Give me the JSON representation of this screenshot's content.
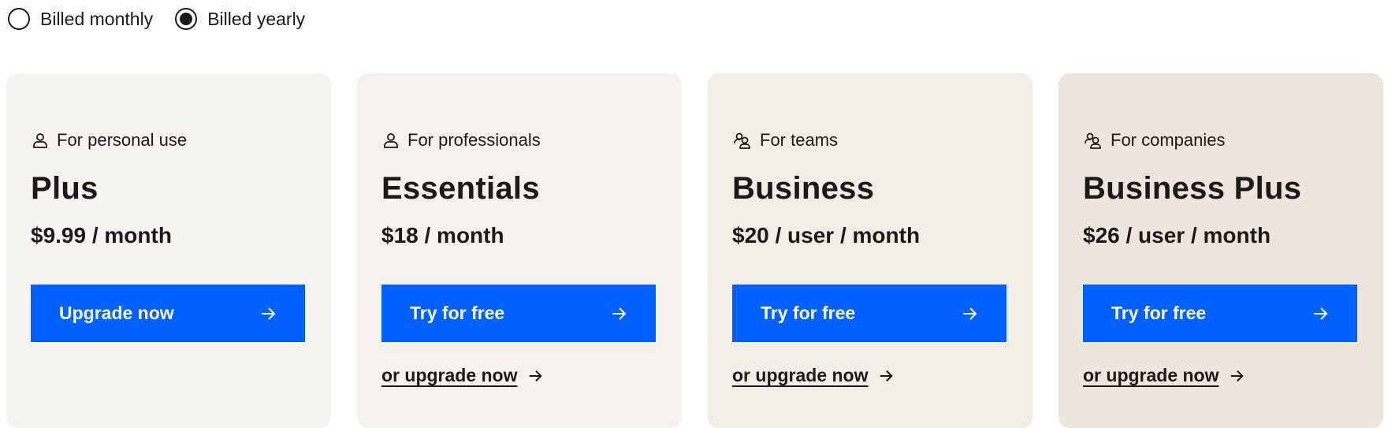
{
  "billing": {
    "options": [
      {
        "label": "Billed monthly",
        "selected": false
      },
      {
        "label": "Billed yearly",
        "selected": true
      }
    ]
  },
  "plans": [
    {
      "audience": "For personal use",
      "audience_icon": "person-icon",
      "name": "Plus",
      "price": "$9.99 / month",
      "cta": "Upgrade now",
      "secondary": "",
      "bg": "#f7f5f2"
    },
    {
      "audience": "For professionals",
      "audience_icon": "person-icon",
      "name": "Essentials",
      "price": "$18 / month",
      "cta": "Try for free",
      "secondary": "or upgrade now",
      "bg": "#f5f2ee"
    },
    {
      "audience": "For teams",
      "audience_icon": "people-icon",
      "name": "Business",
      "price": "$20 / user / month",
      "cta": "Try for free",
      "secondary": "or upgrade now",
      "bg": "#f1ede7"
    },
    {
      "audience": "For companies",
      "audience_icon": "people-icon",
      "name": "Business Plus",
      "price": "$26 / user / month",
      "cta": "Try for free",
      "secondary": "or upgrade now",
      "bg": "#ece6df"
    }
  ],
  "colors": {
    "accent": "#0061fe",
    "text": "#1e1919"
  }
}
